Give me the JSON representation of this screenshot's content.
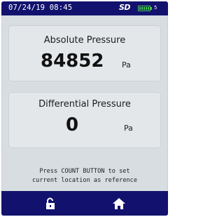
{
  "status_bar": {
    "datetime": "07/24/19 08:45",
    "sd_label": "SD",
    "battery_level": "5",
    "icons": {
      "sd": "sd-card-icon",
      "battery": "battery-icon"
    }
  },
  "absolute_pressure": {
    "title": "Absolute Pressure",
    "value": "84852",
    "unit": "Pa"
  },
  "differential_pressure": {
    "title": "Differential Pressure",
    "value": "0",
    "unit": "Pa"
  },
  "message": {
    "line1": "Press COUNT BUTTON to set",
    "line2": "current location as reference"
  },
  "softkeys": {
    "left_icon": "unlock-icon",
    "right_icon": "home-icon"
  },
  "colors": {
    "bar": "#12126e",
    "screen": "#d8dde2",
    "panel": "#e4e7ea",
    "battery": "#46c84b"
  }
}
